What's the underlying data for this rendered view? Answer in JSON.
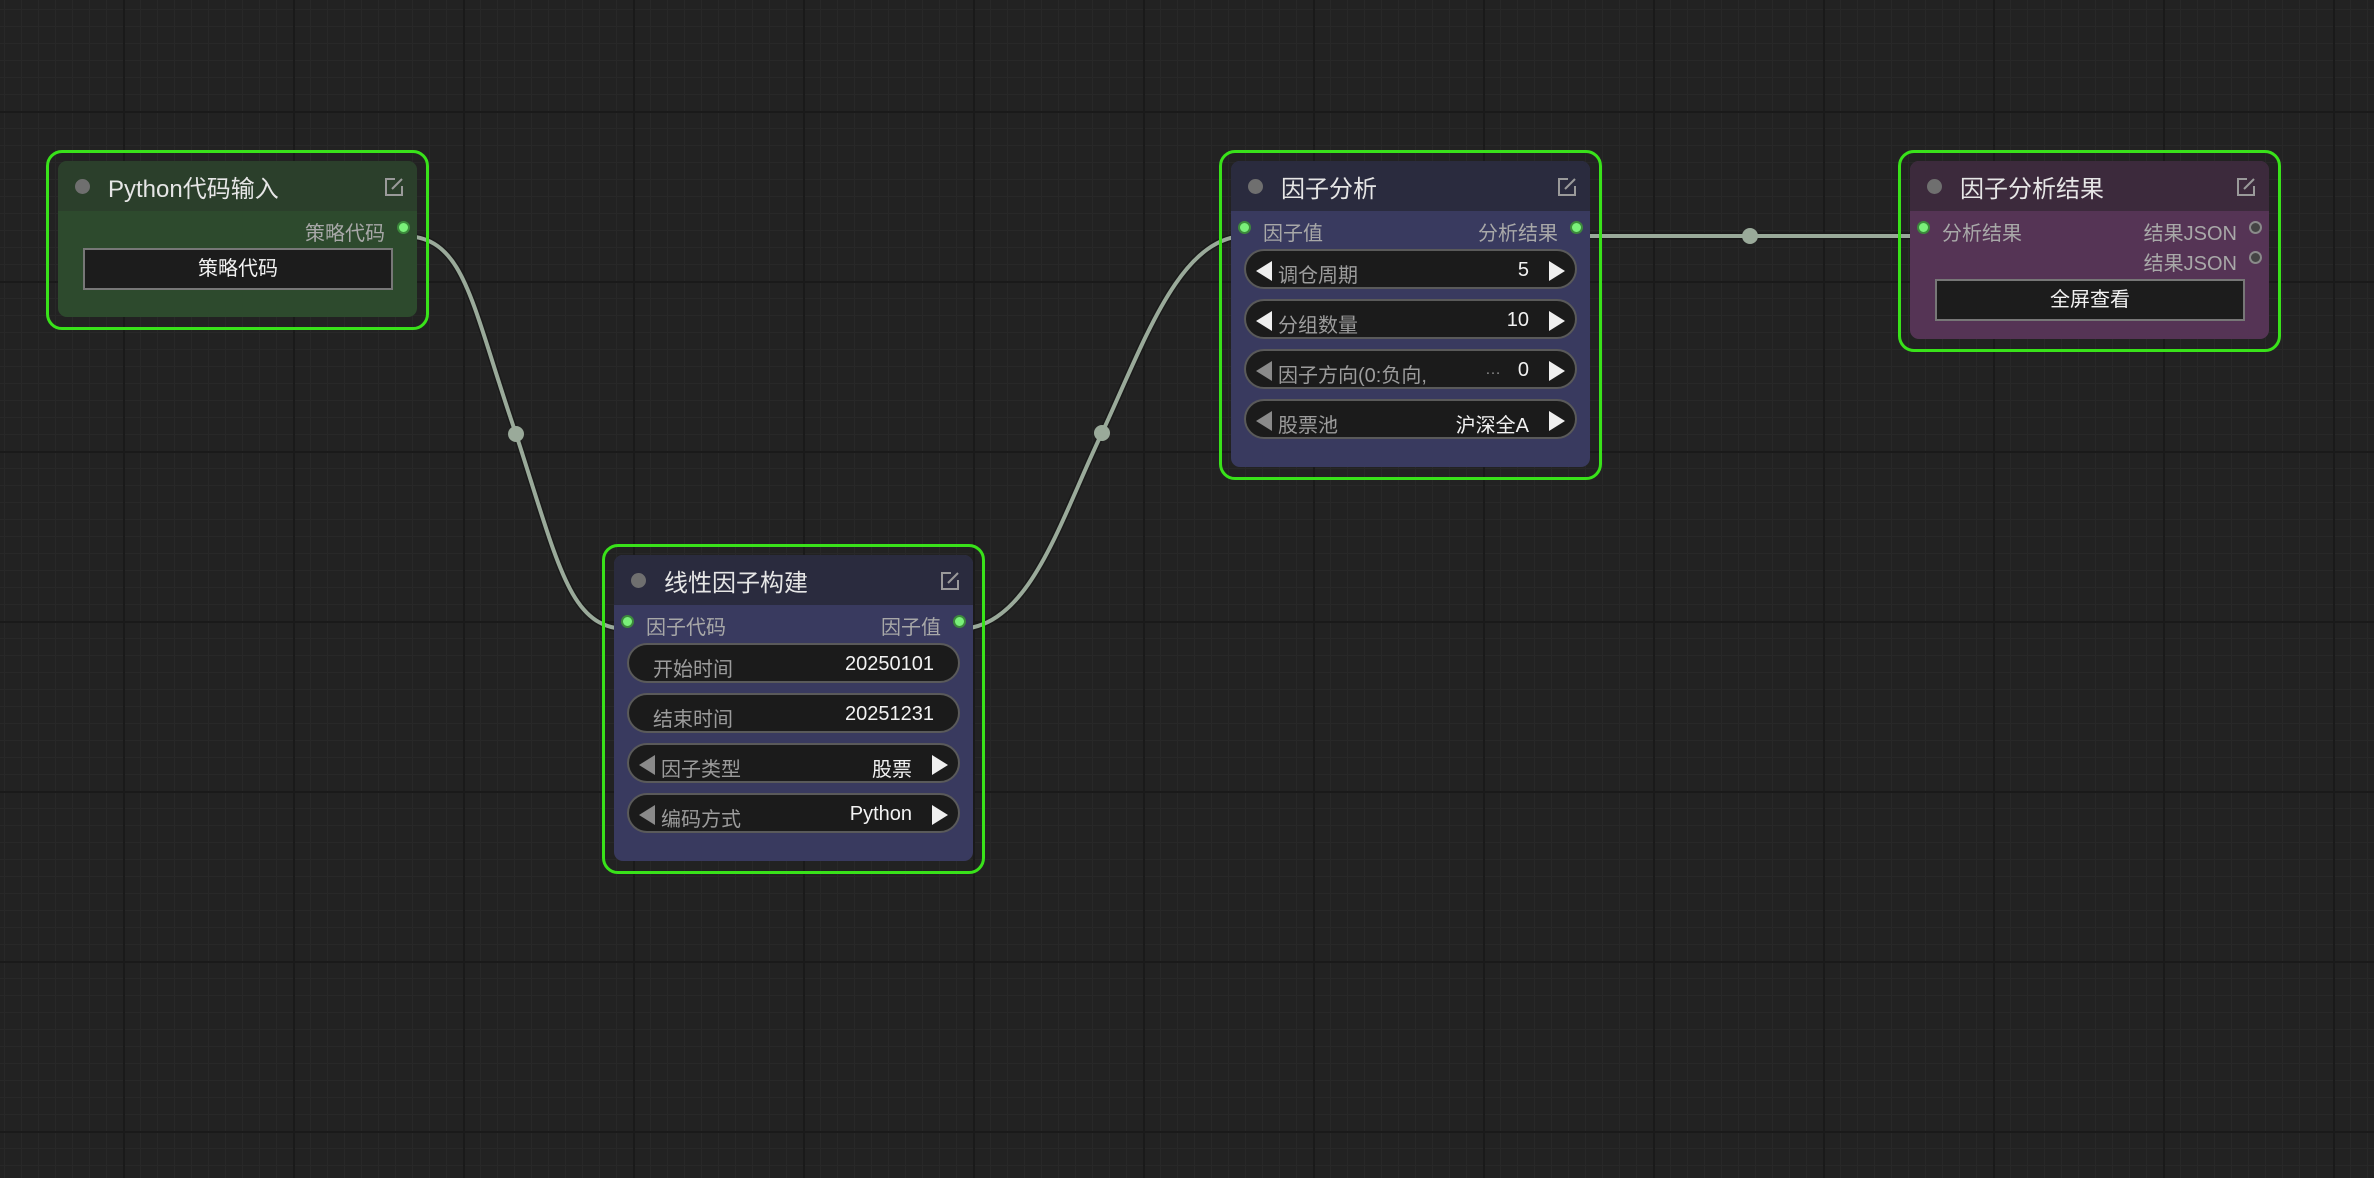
{
  "nodes": {
    "python_input": {
      "title": "Python代码输入",
      "output_label": "策略代码",
      "button_label": "策略代码"
    },
    "linear_factor": {
      "title": "线性因子构建",
      "input_label": "因子代码",
      "output_label": "因子值",
      "widgets": [
        {
          "label": "开始时间",
          "value": "20250101"
        },
        {
          "label": "结束时间",
          "value": "20251231"
        },
        {
          "label": "因子类型",
          "value": "股票"
        },
        {
          "label": "编码方式",
          "value": "Python"
        }
      ]
    },
    "factor_analysis": {
      "title": "因子分析",
      "input_label": "因子值",
      "output_label": "分析结果",
      "widgets": [
        {
          "label": "调仓周期",
          "value": "5"
        },
        {
          "label": "分组数量",
          "value": "10"
        },
        {
          "label": "因子方向(0:负向,",
          "value": "0"
        },
        {
          "label": "股票池",
          "value": "沪深全A"
        }
      ]
    },
    "analysis_result": {
      "title": "因子分析结果",
      "input_label": "分析结果",
      "outputs": [
        "结果JSON",
        "结果JSON"
      ],
      "button_label": "全屏查看"
    }
  },
  "colors": {
    "selection_border": "#39e21a",
    "link": "#9aaa9a",
    "canvas": "#222222"
  }
}
